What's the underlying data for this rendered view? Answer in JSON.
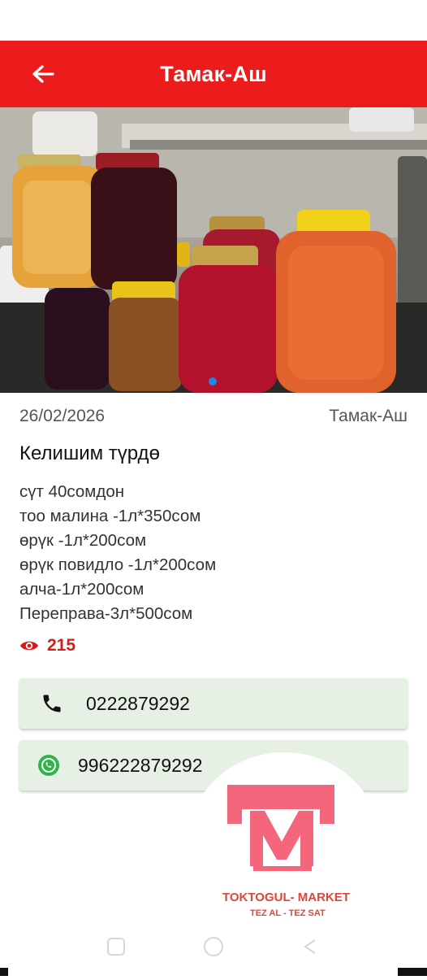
{
  "header": {
    "title": "Тамак-Аш",
    "back_icon": "arrow-left-icon",
    "color": "#ed1c1c"
  },
  "gallery": {
    "image_count": 1,
    "active_index": 0,
    "indicator_color": "#1e88e5"
  },
  "post": {
    "date": "26/02/2026",
    "category": "Тамак-Аш",
    "title": "Келишим түрдө",
    "description": [
      "сүт 40сомдон",
      "тоо малина -1л*350сом",
      "өрүк -1л*200сом",
      "өрүк повидло -1л*200сом",
      "алча-1л*200сом",
      "Переправа-3л*500сом"
    ],
    "views": "215",
    "views_icon": "eye-icon"
  },
  "contacts": {
    "phone": {
      "icon": "phone-icon",
      "number": "0222879292"
    },
    "whatsapp": {
      "icon": "whatsapp-icon",
      "number": "996222879292"
    }
  },
  "logo": {
    "name": "TOKTOGUL- MARKET",
    "tagline": "TEZ AL - TEZ SAT",
    "primary_color": "#f4667c",
    "text_color": "#e0443a"
  }
}
